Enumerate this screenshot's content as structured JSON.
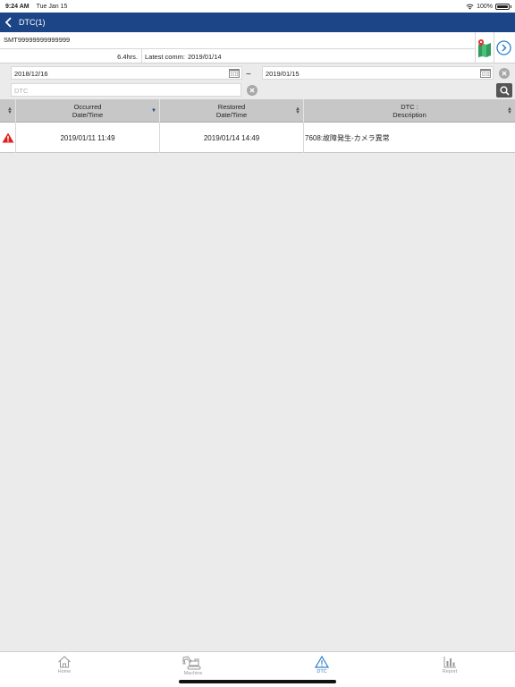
{
  "status_bar": {
    "time": "9:24 AM",
    "date": "Tue Jan 15",
    "battery": "100%",
    "battery_level": 1.0
  },
  "navbar": {
    "title": "DTC(1)"
  },
  "machine": {
    "serial": "SMT99999999999999",
    "hours": "6.4hrs.",
    "latest_comm_label": "Latest comm:",
    "latest_comm_value": "2019/01/14"
  },
  "filter": {
    "date_from": "2018/12/16",
    "date_to": "2019/01/15",
    "separator": "~",
    "dtc_placeholder": "DTC"
  },
  "table": {
    "columns": [
      {
        "line1": "Occurred",
        "line2": "Date/Time"
      },
      {
        "line1": "Restored",
        "line2": "Date/Time"
      },
      {
        "line1": "DTC :",
        "line2": "Description"
      }
    ],
    "rows": [
      {
        "occurred": "2019/01/11 11:49",
        "restored": "2019/01/14 14:49",
        "description": "7608:故障発生-カメラ異常"
      }
    ]
  },
  "tabs": [
    {
      "label": "Home",
      "icon": "home-icon"
    },
    {
      "label": "Machine",
      "icon": "excavator-icon"
    },
    {
      "label": "DTC",
      "icon": "warning-icon",
      "active": true
    },
    {
      "label": "Report",
      "icon": "bar-chart-icon"
    }
  ],
  "colors": {
    "navbar": "#1c4587",
    "active_tab": "#2f7fc7",
    "warning": "#e02020"
  }
}
